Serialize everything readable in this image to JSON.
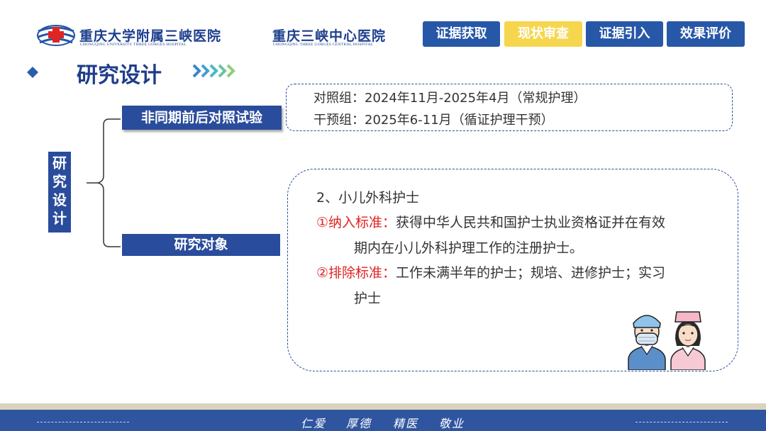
{
  "header": {
    "hospital_1": "重庆大学附属三峡医院",
    "hospital_1_en": "CHONGQING UNIVERSITY THREE GORGES HOSPITAL",
    "hospital_2": "重庆三峡中心医院",
    "hospital_2_en": "CHONGQING THREE GORGES CENTRAL HOSPITAL",
    "tabs": [
      {
        "label": "证据获取",
        "active": false
      },
      {
        "label": "现状审查",
        "active": true
      },
      {
        "label": "证据引入",
        "active": false
      },
      {
        "label": "效果评价",
        "active": false
      }
    ]
  },
  "title": "研究设计",
  "root_label": [
    "研",
    "究",
    "设",
    "计"
  ],
  "branch_1": {
    "label": "非同期前后对照试验",
    "lines": [
      "对照组：2024年11月-2025年4月（常规护理）",
      "干预组：2025年6-11月（循证护理干预）"
    ]
  },
  "branch_2": {
    "label": "研究对象",
    "heading": "2、小儿外科护士",
    "inclusion_label": "①纳入标准：",
    "inclusion_text_1": "获得中华人民共和国护士执业资格证并在有效",
    "inclusion_text_2": "期内在小儿外科护理工作的注册护士。",
    "exclusion_label": "②排除标准：",
    "exclusion_text_1": "工作未满半年的护士；规培、进修护士；实习",
    "exclusion_text_2": "护士"
  },
  "footer": {
    "motto": [
      "仁爱",
      "厚德",
      "精医",
      "敬业"
    ]
  },
  "colors": {
    "navy": "#2a4c9c",
    "tab_blue": "#2757a7",
    "tab_active": "#f6d64e",
    "red": "#e02424",
    "title": "#1f3d8a",
    "chevron": "#4aa6d8"
  }
}
